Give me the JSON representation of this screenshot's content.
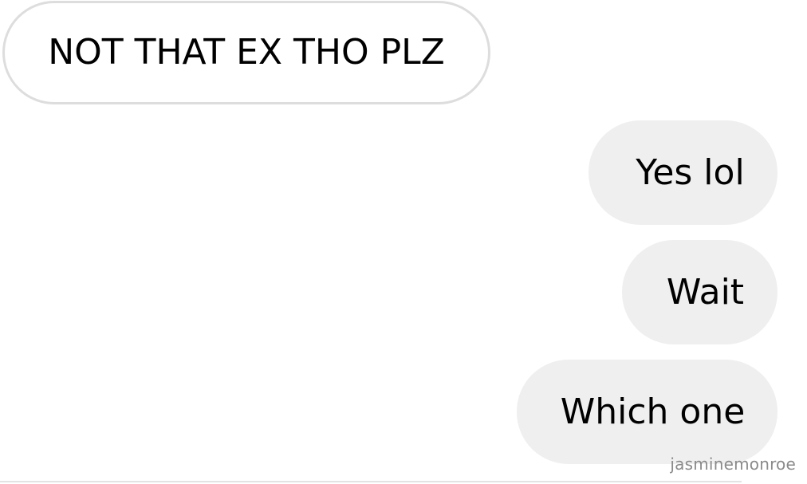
{
  "conversation": {
    "incoming": [
      {
        "text": "NOT THAT EX THO PLZ"
      }
    ],
    "outgoing": [
      {
        "text": "Yes lol"
      },
      {
        "text": "Wait"
      },
      {
        "text": "Which one"
      }
    ]
  },
  "watermark": "jasminemonroe",
  "colors": {
    "incoming_bubble_background": "#ffffff",
    "incoming_bubble_border": "#dddddd",
    "outgoing_bubble_background": "#efefef",
    "message_text": "#000000",
    "watermark_text": "#8a8a8a"
  }
}
